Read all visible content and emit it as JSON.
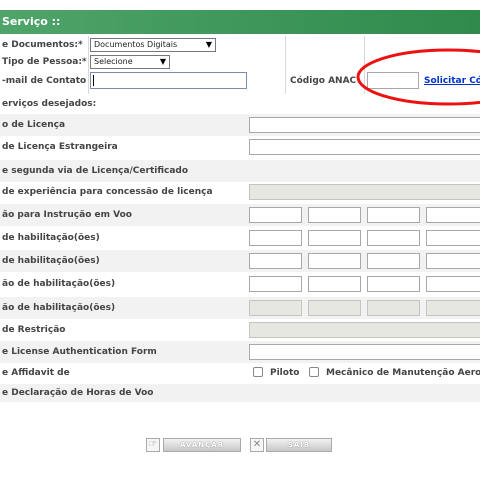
{
  "header": {
    "title": "Serviço ::"
  },
  "form": {
    "tipo_documentos_label": "e Documentos:*",
    "tipo_documentos_value": "Documentos Digitais",
    "tipo_pessoa_label": "Tipo de Pessoa:*",
    "tipo_pessoa_value": "Selecione",
    "email_label": "-mail de Contato",
    "email_value": "",
    "codigo_anac_label": "Código ANAC",
    "codigo_anac_value": "",
    "solicitar_link": "Solicitar Có"
  },
  "section_title": "erviços desejados:",
  "services": [
    "o de Licença",
    "de Licença Estrangeira",
    "e segunda via de Licença/Certificado",
    "de experiência para concessão de licença",
    "ão para Instrução em Voo",
    "de habilitação(ões)",
    "de habilitação(ões)",
    "ão de habilitação(ões)",
    "ão de habilitação(ões)",
    "de Restrição",
    "e License Authentication Form",
    "e Affidavit de",
    "e Declaração de Horas de Voo"
  ],
  "affidavit_options": {
    "piloto": "Piloto",
    "mecanico": "Mecânico de Manutenção Aero"
  },
  "buttons": {
    "avancar": "AVANÇAR",
    "sair": "SAIR"
  },
  "colors": {
    "header_green": "#2f8a4c",
    "annotation_red": "#ee1111",
    "link_blue": "#0033cc"
  }
}
